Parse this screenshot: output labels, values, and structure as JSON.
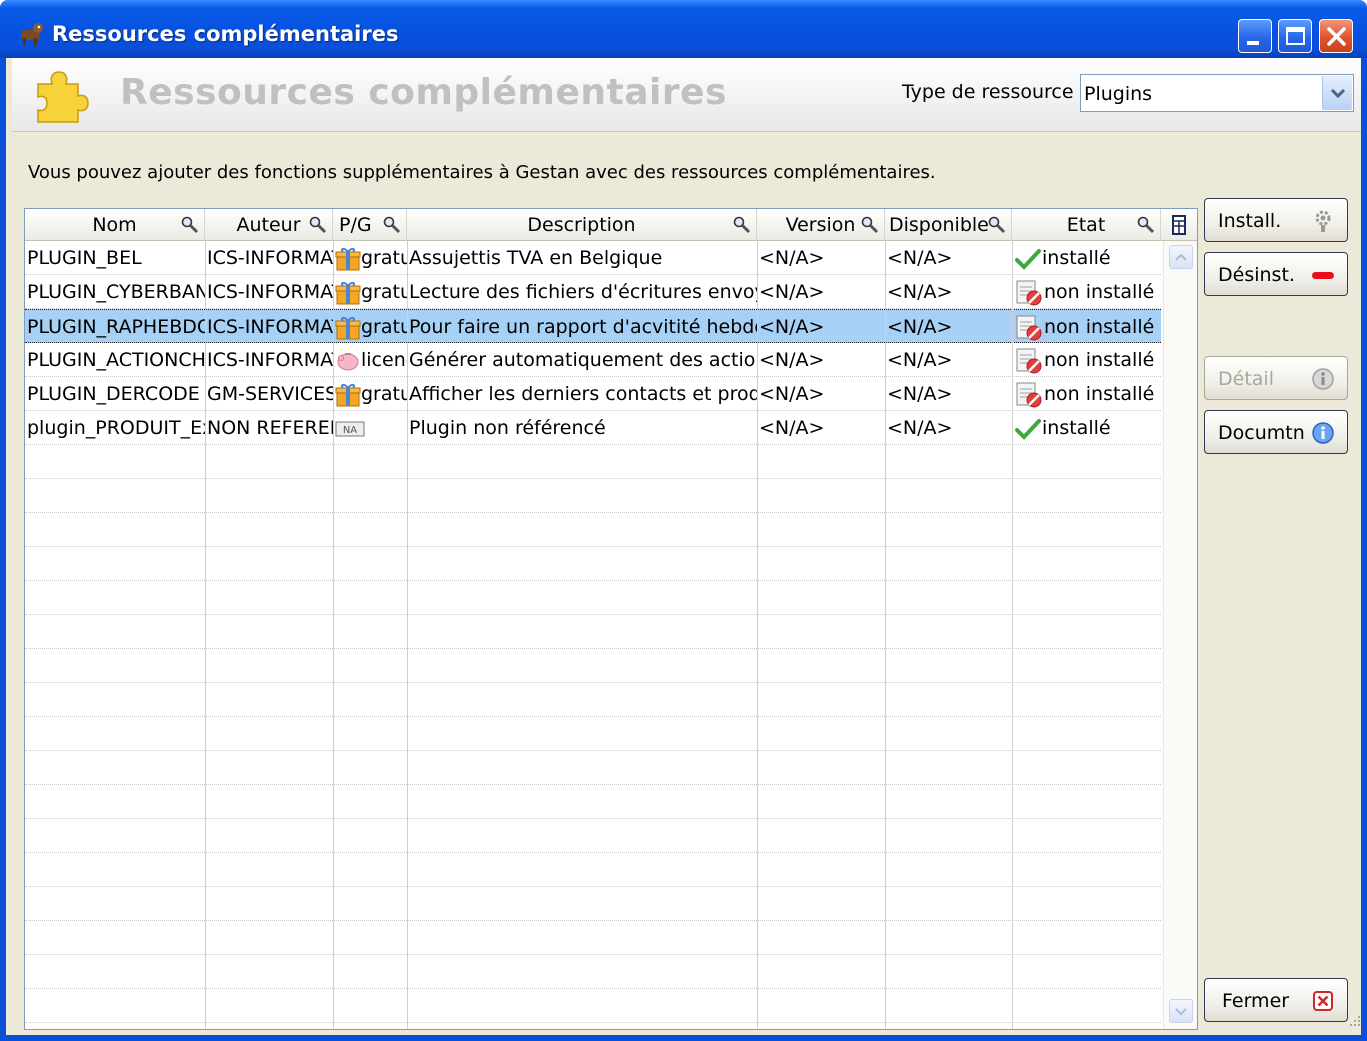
{
  "window": {
    "title": "Ressources complémentaires"
  },
  "header": {
    "title": "Ressources complémentaires",
    "type_label": "Type de ressource",
    "type_value": "Plugins"
  },
  "intro_text": "Vous pouvez ajouter des fonctions supplémentaires à Gestan avec des ressources complémentaires.",
  "table": {
    "columns": [
      "Nom",
      "Auteur",
      "P/G",
      "Description",
      "Version",
      "Disponible",
      "Etat"
    ],
    "rows": [
      {
        "nom": "PLUGIN_BEL",
        "auteur": "ICS-INFORMATIQUE",
        "pg": "gratuit",
        "pg_icon": "gift-icon",
        "description": "Assujettis TVA en Belgique",
        "version": "<N/A>",
        "disponible": "<N/A>",
        "etat": "installé",
        "etat_icon": "check-icon"
      },
      {
        "nom": "PLUGIN_CYBERBANQUE",
        "auteur": "ICS-INFORMATIQUE",
        "pg": "gratuit",
        "pg_icon": "gift-icon",
        "description": "Lecture des fichiers d'écritures envoyés",
        "version": "<N/A>",
        "disponible": "<N/A>",
        "etat": "non installé",
        "etat_icon": "not-installed-icon"
      },
      {
        "nom": "PLUGIN_RAPHEBDO",
        "auteur": "ICS-INFORMATIQUE",
        "pg": "gratuit",
        "pg_icon": "gift-icon",
        "description": "Pour faire un rapport d'acvitité hebdomadaire",
        "version": "<N/A>",
        "disponible": "<N/A>",
        "etat": "non installé",
        "etat_icon": "not-installed-icon"
      },
      {
        "nom": "PLUGIN_ACTIONCH",
        "auteur": "ICS-INFORMATIQUE",
        "pg": "licence",
        "pg_icon": "piggy-bank-icon",
        "description": "Générer automatiquement des actions",
        "version": "<N/A>",
        "disponible": "<N/A>",
        "etat": "non installé",
        "etat_icon": "not-installed-icon"
      },
      {
        "nom": "PLUGIN_DERCODE",
        "auteur": "GM-SERVICES",
        "pg": "gratuit",
        "pg_icon": "gift-icon",
        "description": "Afficher les derniers contacts et produits",
        "version": "<N/A>",
        "disponible": "<N/A>",
        "etat": "non installé",
        "etat_icon": "not-installed-icon"
      },
      {
        "nom": "plugin_PRODUIT_Ex",
        "auteur": "NON REFERENCE",
        "pg": "",
        "pg_icon": "na-badge-icon",
        "pg_badge": "NA",
        "description": "Plugin non référencé",
        "version": "<N/A>",
        "disponible": "<N/A>",
        "etat": "installé",
        "etat_icon": "check-icon"
      }
    ],
    "selected_row": 2
  },
  "buttons": {
    "install": "Install.",
    "uninstall": "Désinst.",
    "detail": "Détail",
    "documentation": "Documtn",
    "close": "Fermer"
  },
  "colors": {
    "titlebar": "#0a4fd8",
    "selection": "#a6d0f5",
    "header_title": "#c0c0c0"
  }
}
